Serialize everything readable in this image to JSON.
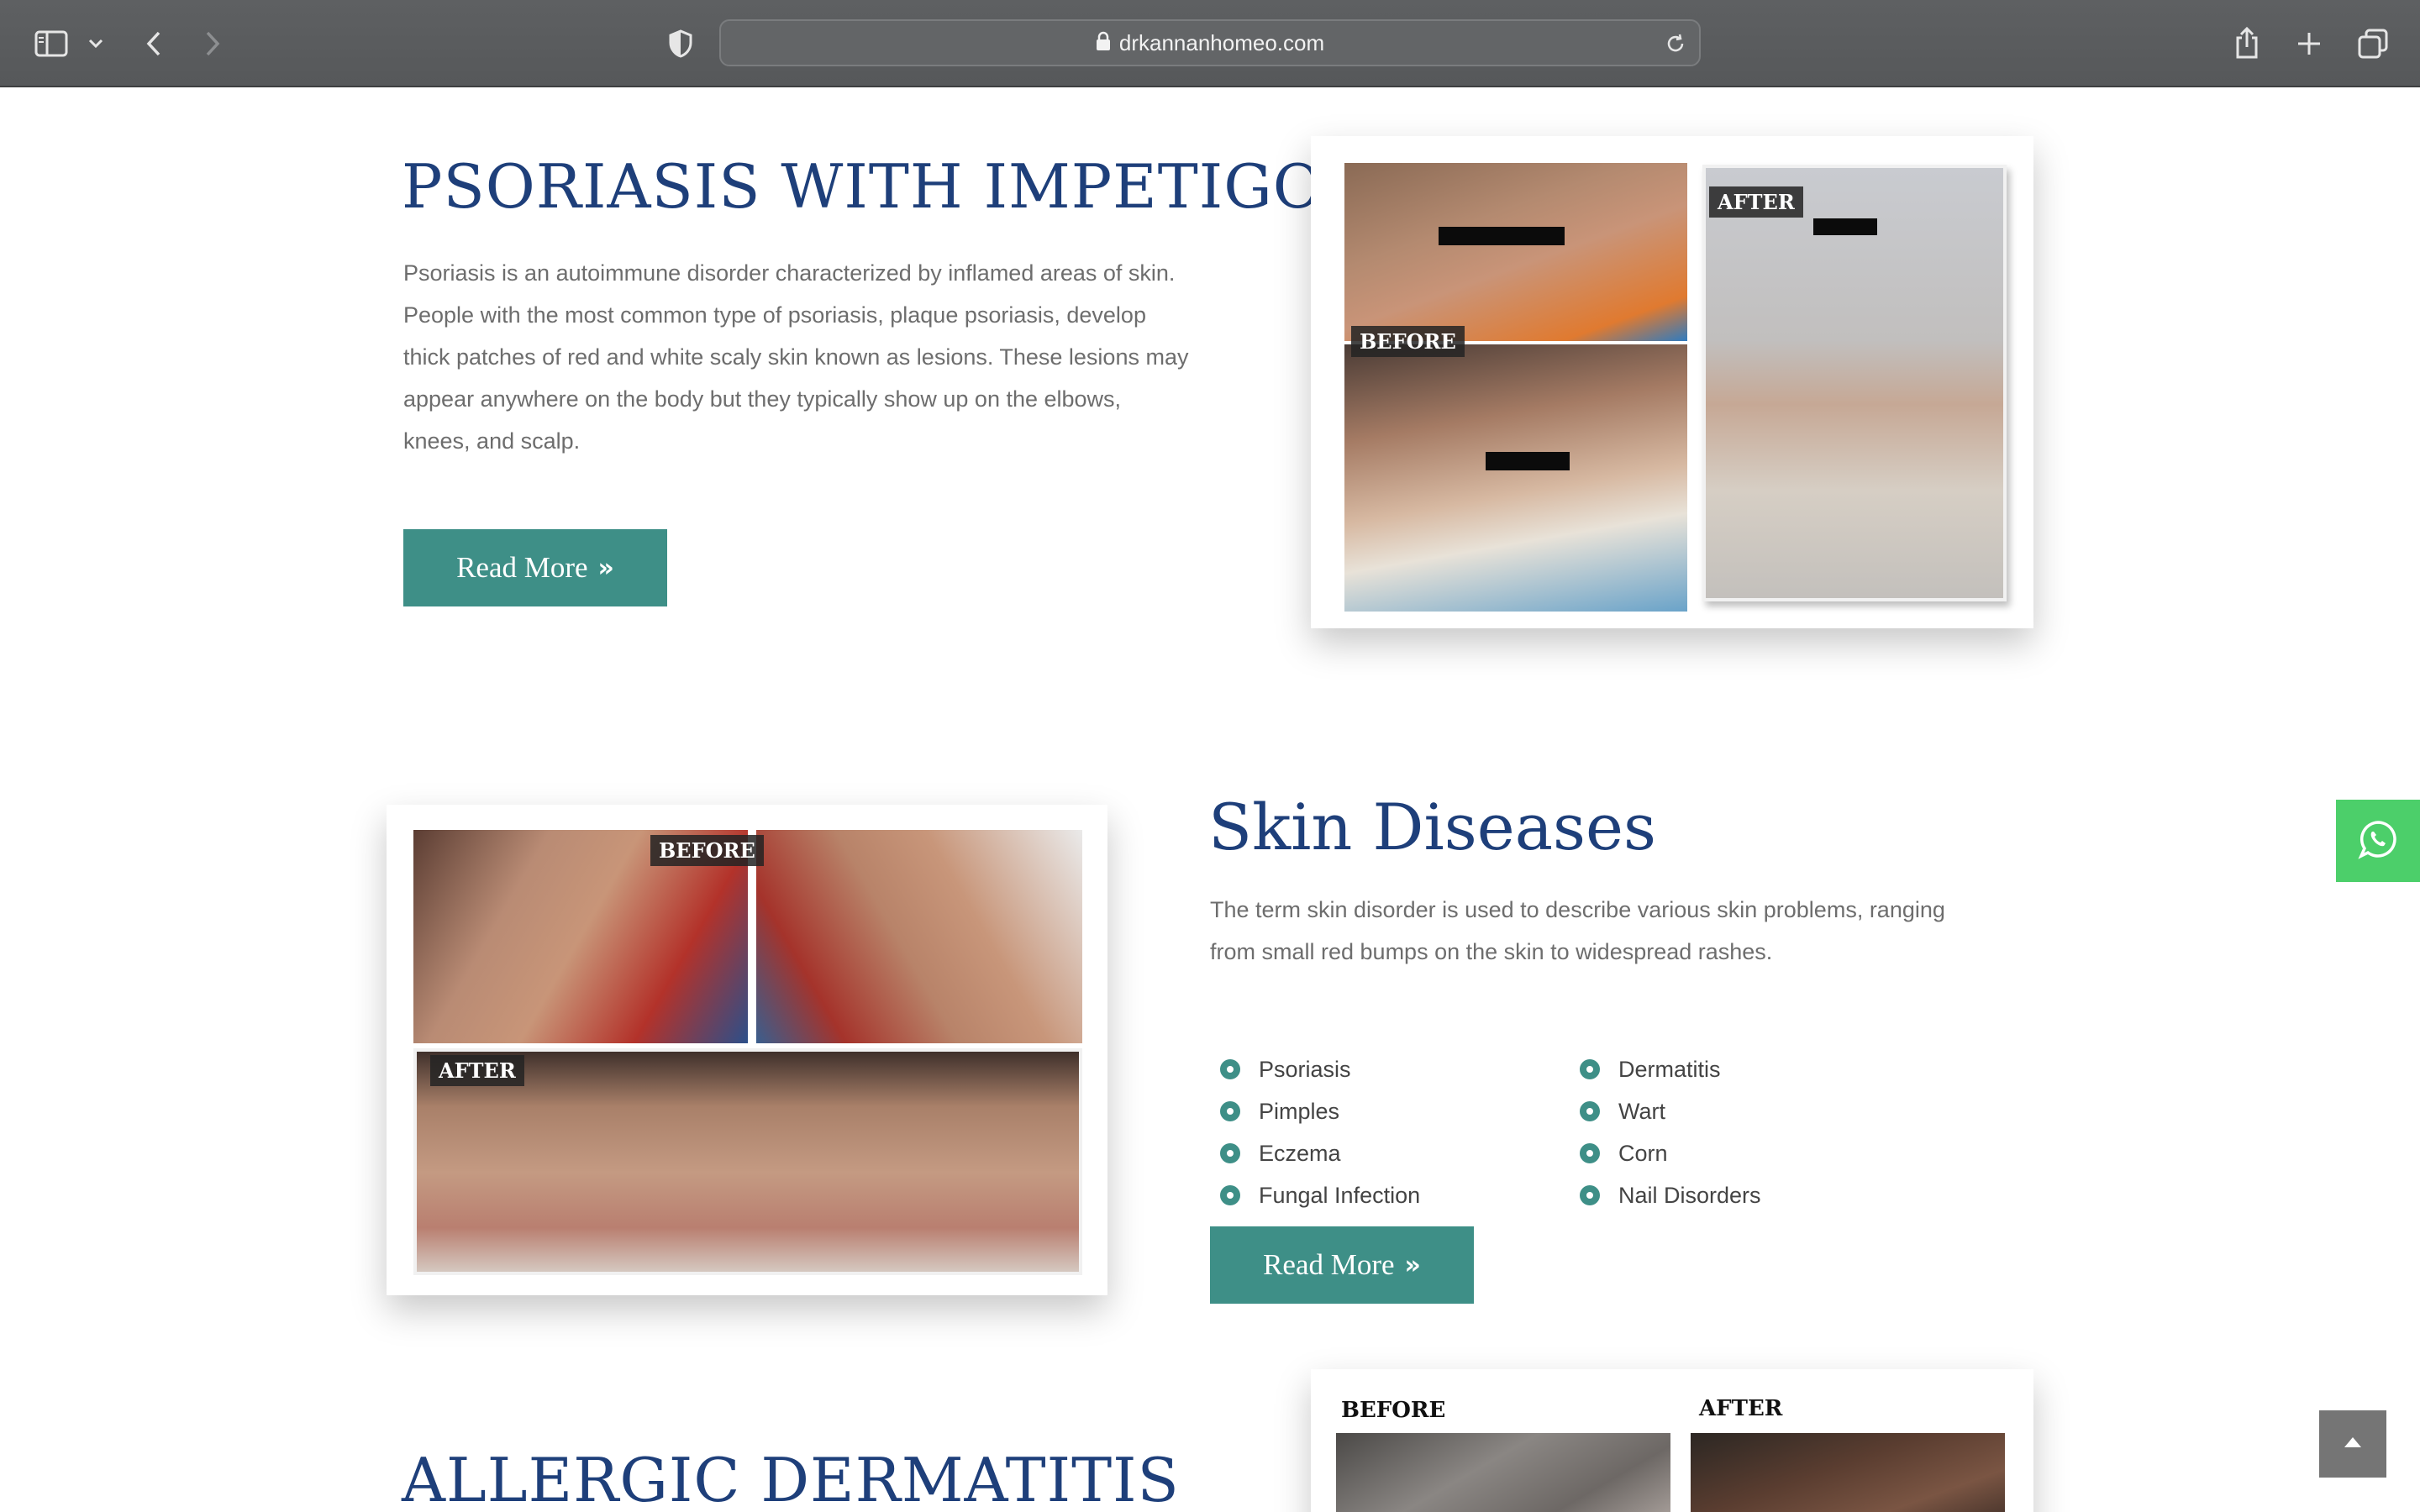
{
  "browser": {
    "url": "drkannanhomeo.com",
    "icons": [
      "sidebar-icon",
      "chevron-down-icon",
      "back-icon",
      "forward-icon",
      "shield-icon",
      "lock-icon",
      "reload-icon",
      "share-icon",
      "plus-icon",
      "tabs-icon"
    ]
  },
  "section1": {
    "title": "PSORIASIS WITH IMPETIGO",
    "text": "Psoriasis is an autoimmune disorder characterized by inflamed areas of skin. People with the most common type of psoriasis, plaque psoriasis, develop thick patches of red and white scaly skin known as lesions. These lesions may appear anywhere on the body but they typically show up on the elbows, knees, and scalp.",
    "button": "Read More",
    "image_tags": {
      "before": "BEFORE",
      "after": "AFTER"
    }
  },
  "section2": {
    "title": "Skin Diseases",
    "text": "The term skin disorder is used to describe various skin problems, ranging from small red bumps on the skin to widespread rashes.",
    "list_left": [
      "Psoriasis",
      "Pimples",
      "Eczema",
      "Fungal Infection"
    ],
    "list_right": [
      "Dermatitis",
      "Wart",
      "Corn",
      "Nail Disorders"
    ],
    "button": "Read More",
    "image_tags": {
      "before": "BEFORE",
      "after": "AFTER"
    }
  },
  "section3": {
    "title": "ALLERGIC DERMATITIS",
    "image_tags": {
      "before": "BEFORE",
      "after": "AFTER"
    }
  },
  "colors": {
    "heading": "#1e3f7a",
    "accent": "#3e8f87",
    "whatsapp": "#4ccf6a"
  },
  "floating": {
    "whatsapp_icon": "whatsapp-icon",
    "scroll_top_icon": "chevron-up-icon"
  }
}
